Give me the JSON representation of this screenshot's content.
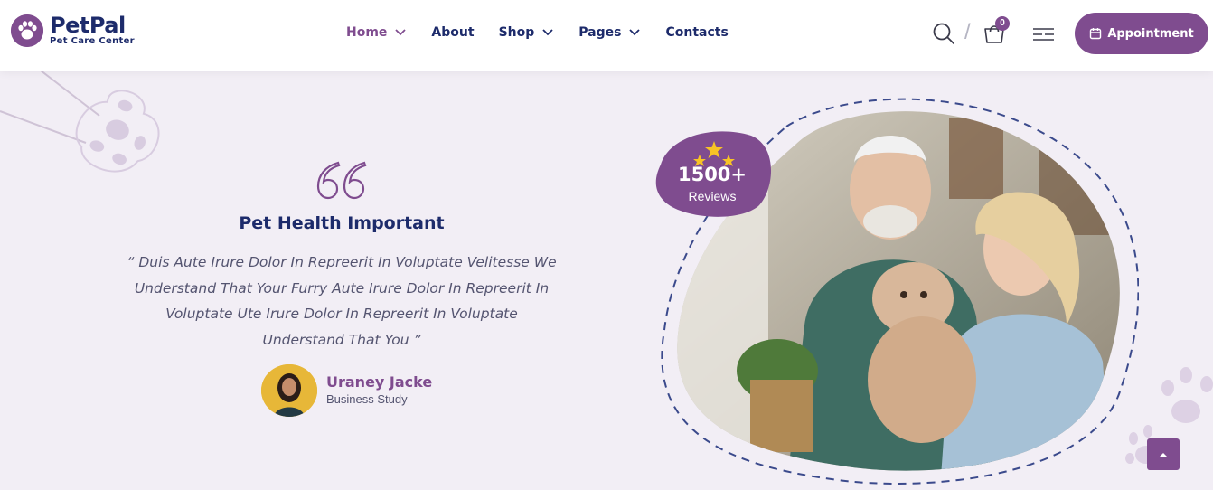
{
  "brand": {
    "name": "PetPal",
    "tagline": "Pet Care Center",
    "logo_icon": "paw-icon"
  },
  "nav": {
    "items": [
      {
        "label": "Home",
        "has_dropdown": true,
        "active": true
      },
      {
        "label": "About",
        "has_dropdown": false,
        "active": false
      },
      {
        "label": "Shop",
        "has_dropdown": true,
        "active": false
      },
      {
        "label": "Pages",
        "has_dropdown": true,
        "active": false
      },
      {
        "label": "Contacts",
        "has_dropdown": false,
        "active": false
      }
    ]
  },
  "header": {
    "search_icon": "search-icon",
    "separator": "/",
    "cart_count": "0",
    "menu_icon": "hamburger-icon",
    "appointment_label": "Appointment"
  },
  "testimonial": {
    "title": "Pet Health Important",
    "quote": "“ Duis Aute Irure Dolor In Repreerit In Voluptate Velitesse We Understand That Your Furry Aute Irure Dolor In Repreerit In Voluptate Ute Irure Dolor In Repreerit In Voluptate Understand That You ”",
    "author_name": "Uraney Jacke",
    "author_role": "Business Study"
  },
  "reviews": {
    "count": "1500+",
    "label": "Reviews",
    "stars": 3
  },
  "colors": {
    "primary": "#7f4c8f",
    "navy": "#1d2b6b",
    "background": "#f2eef5",
    "star": "#f7c325"
  }
}
